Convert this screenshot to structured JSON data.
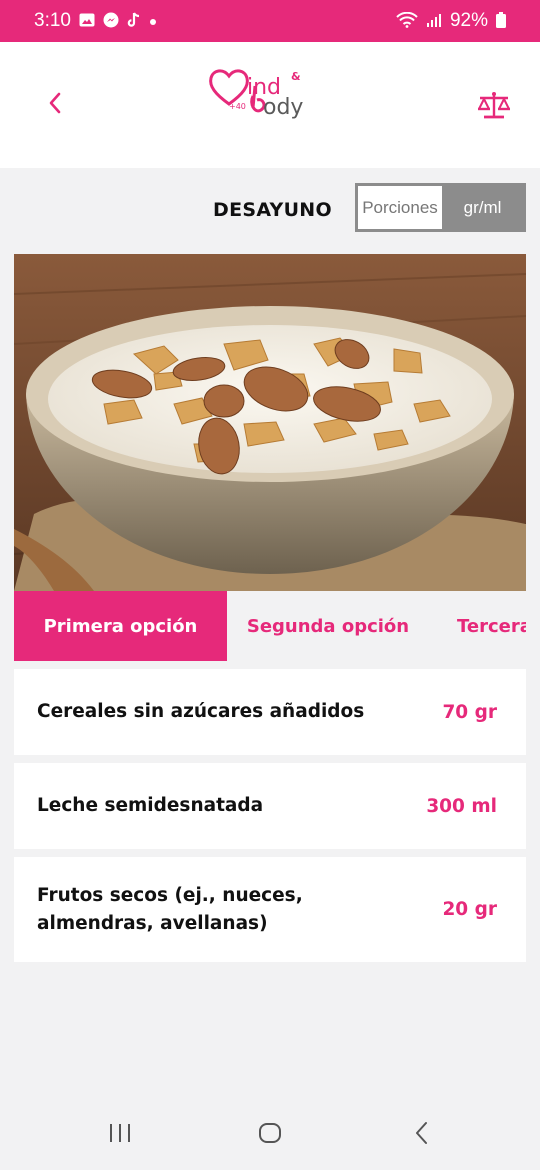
{
  "status_bar": {
    "time": "3:10",
    "battery": "92%",
    "notification_icons": [
      "gallery-icon",
      "messenger-icon",
      "tiktok-icon",
      "dot-icon"
    ],
    "system_icons": [
      "wifi-icon",
      "signal-icon",
      "battery-icon"
    ]
  },
  "header": {
    "logo": {
      "brand_part1": "ind",
      "brand_part2": "ody",
      "ampersand": "&",
      "age_tag": "+40"
    },
    "back_icon": "chevron-left-icon",
    "scale_icon": "scale-icon"
  },
  "meal": {
    "title": "DESAYUNO",
    "unit_options": [
      "Porciones",
      "gr/ml"
    ],
    "selected_unit": "gr/ml"
  },
  "tabs": [
    {
      "label": "Primera opción",
      "active": true
    },
    {
      "label": "Segunda opción",
      "active": false
    },
    {
      "label": "Tercera",
      "active": false
    }
  ],
  "items": [
    {
      "name": "Cereales sin azúcares añadidos",
      "quantity": "70 gr"
    },
    {
      "name": "Leche semidesnatada",
      "quantity": "300 ml"
    },
    {
      "name": "Frutos secos (ej., nueces, almendras, avellanas)",
      "quantity": "20 gr"
    }
  ],
  "colors": {
    "brand": "#e6297a",
    "background": "#f2f2f3",
    "toggle_gray": "#8c8c8c"
  },
  "navbar": {
    "icons": [
      "recent-apps-icon",
      "home-icon",
      "back-nav-icon"
    ]
  }
}
